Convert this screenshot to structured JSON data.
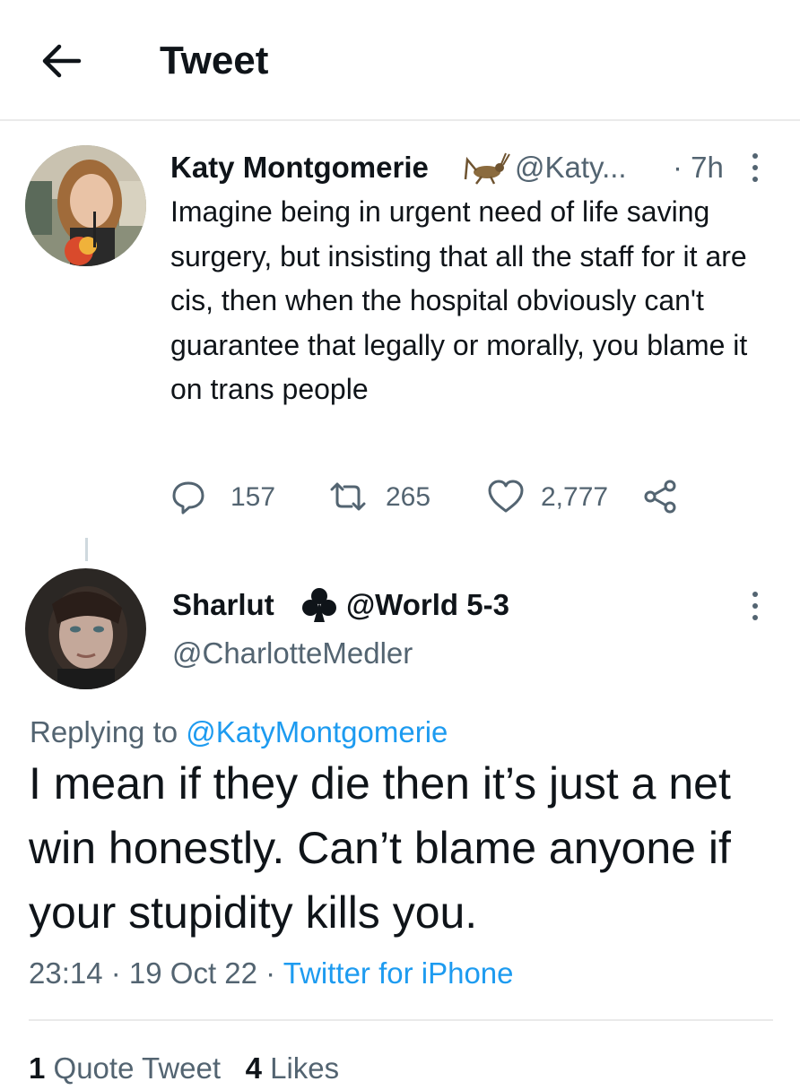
{
  "header": {
    "title": "Tweet"
  },
  "tweet": {
    "author_name": "Katy Montgomerie",
    "author_handle": "@Katy...",
    "time": "· 7h",
    "text": "Imagine being in urgent need of life saving surgery, but insisting that all the staff for it are cis, then when the hospital obviously can't guarantee that legally or morally, you blame it on trans people",
    "replies": "157",
    "retweets": "265",
    "likes": "2,777"
  },
  "reply": {
    "author_name": "Sharlut",
    "author_name_suffix": "@World 5-3",
    "author_handle": "@CharlotteMedler",
    "replying_prefix": "Replying to ",
    "replying_to": "@KatyMontgomerie",
    "text": "I mean if they die then it’s just a net win honestly. Can’t blame anyone if your stupidity kills you.",
    "timestamp": "23:14 · 19 Oct 22 · ",
    "source": "Twitter for iPhone",
    "quote_count": "1",
    "quote_label": " Quote Tweet",
    "like_count": "4",
    "like_label": " Likes"
  },
  "icons": {
    "back": "arrow-left-icon",
    "more": "more-vertical-icon",
    "reply": "reply-icon",
    "retweet": "retweet-icon",
    "like": "heart-icon",
    "share": "share-icon",
    "cricket_emoji": "cricket-icon",
    "club_emoji": "club-icon"
  },
  "colors": {
    "accent": "#1d9bf0",
    "secondary_text": "#536471",
    "primary_text": "#0f1419"
  }
}
